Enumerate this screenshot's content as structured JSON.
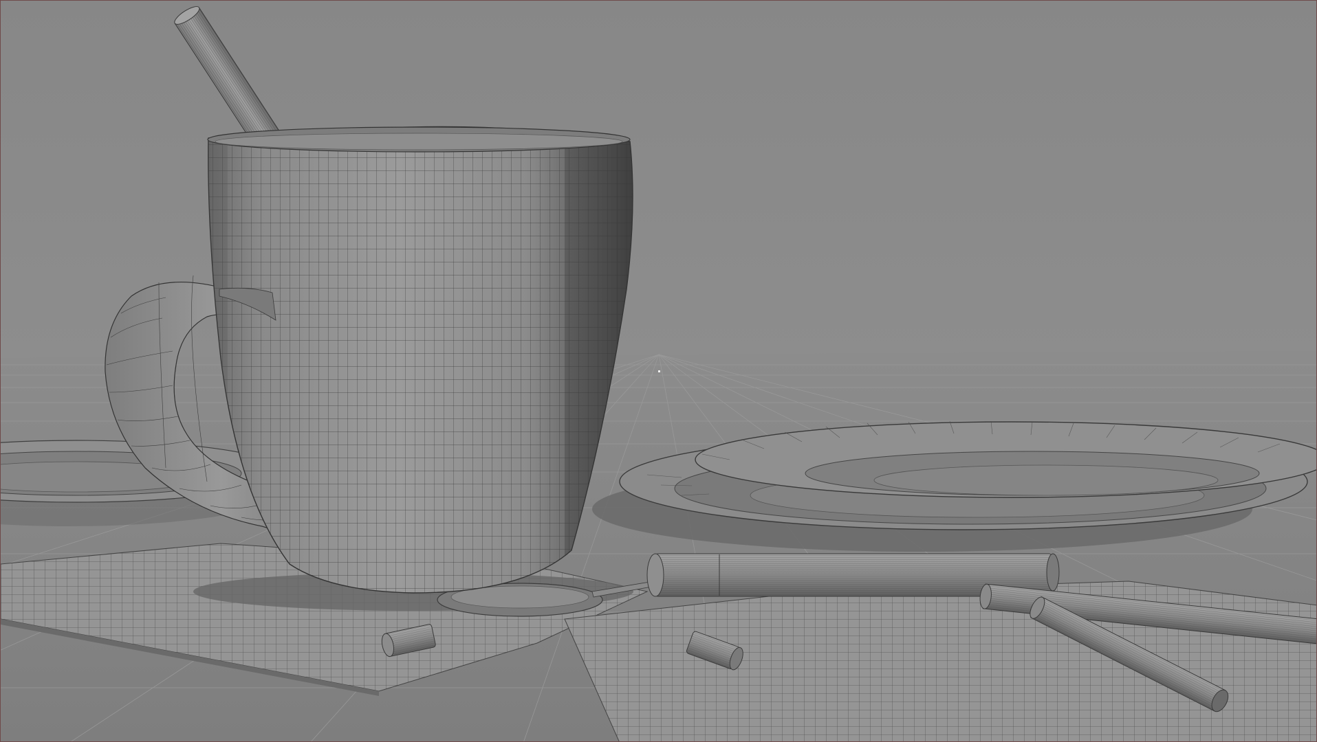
{
  "viewport": {
    "kind": "3d-viewport",
    "shading": "solid-wireframe",
    "colors": {
      "background_top": "#898989",
      "background_horizon": "#8e8e8e",
      "floor": "#8a8a8a",
      "grid": "#9a9a9a",
      "mesh_light": "#9a9a9a",
      "mesh_mid": "#7c7c7c",
      "mesh_dark": "#4c4c4c",
      "wire": "#3a3a3a",
      "shadow": "#666666",
      "border": "#6f4a4a"
    },
    "objects": [
      {
        "name": "mug",
        "icon": "mug-mesh"
      },
      {
        "name": "stirrer",
        "icon": "cylinder-mesh"
      },
      {
        "name": "plate",
        "icon": "plate-mesh"
      },
      {
        "name": "plate-left",
        "icon": "plate-mesh"
      },
      {
        "name": "spoon",
        "icon": "spoon-mesh"
      },
      {
        "name": "napkin",
        "icon": "plane-mesh"
      },
      {
        "name": "pens",
        "icon": "cylinder-mesh"
      },
      {
        "name": "caps",
        "icon": "cylinder-mesh"
      }
    ]
  }
}
